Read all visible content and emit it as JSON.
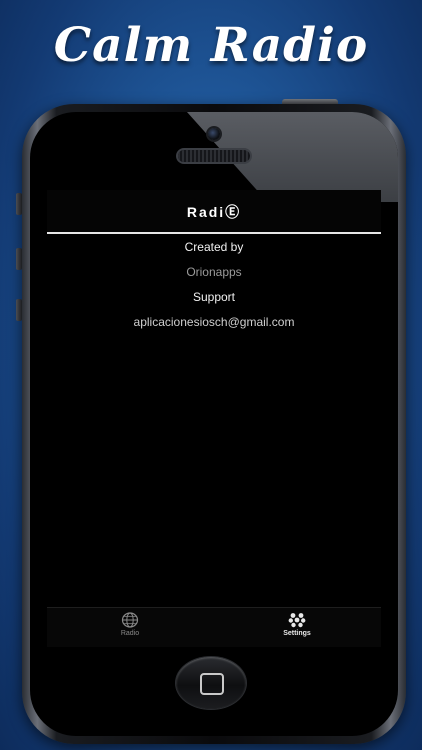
{
  "promo": {
    "title": "Calm Radio"
  },
  "app": {
    "nav_title": "RadiⒺ",
    "credits": {
      "created_by_label": "Created by",
      "author": "Orionapps",
      "support_label": "Support",
      "email": "aplicacionesiosch@gmail.com"
    },
    "tabs": [
      {
        "label": "Radio",
        "icon": "globe-icon",
        "selected": false
      },
      {
        "label": "Settings",
        "icon": "settings-icon",
        "selected": true
      }
    ]
  },
  "colors": {
    "background": "#1f5799",
    "screen": "#000000",
    "text_primary": "#ffffff",
    "text_secondary": "#9a9a9a"
  }
}
